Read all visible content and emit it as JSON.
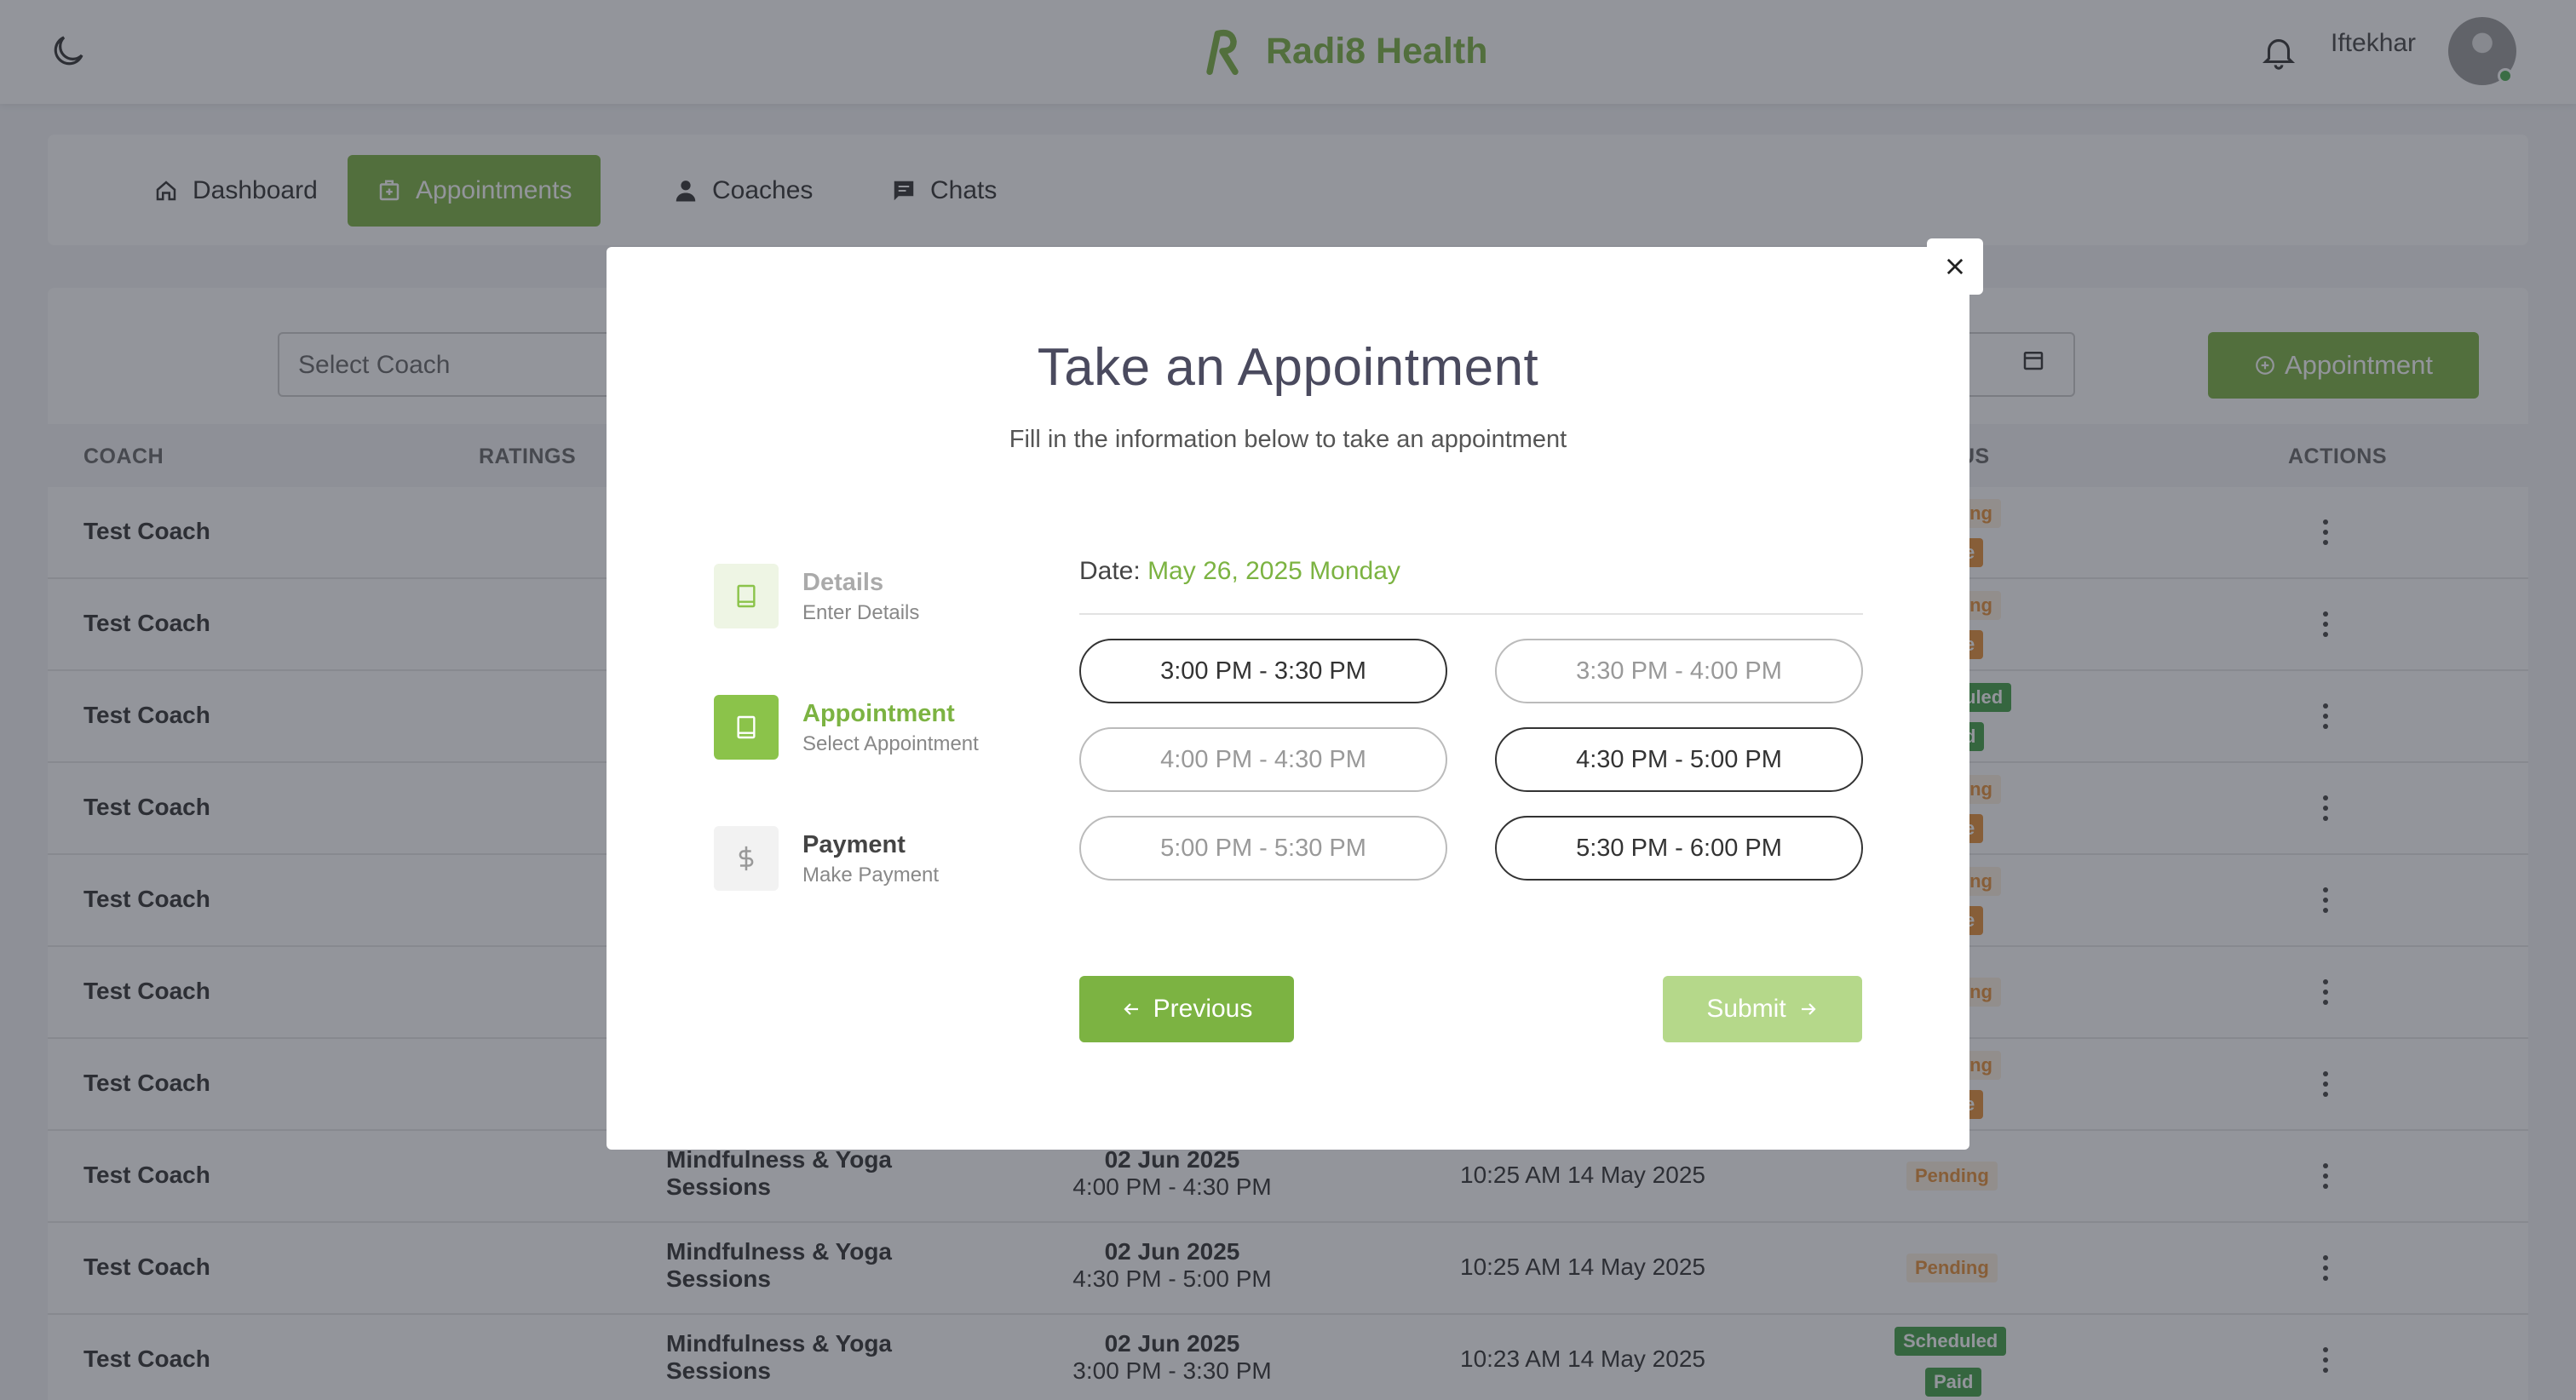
{
  "colors": {
    "accent": "#7cb342",
    "pending": "#e69138",
    "scheduled": "#43a047"
  },
  "header": {
    "brand": "Radi8 Health",
    "username": "Iftekhar"
  },
  "nav": {
    "items": [
      {
        "label": "Dashboard",
        "icon": "home-icon"
      },
      {
        "label": "Appointments",
        "icon": "calendar-plus-icon",
        "active": true
      },
      {
        "label": "Coaches",
        "icon": "coach-icon"
      },
      {
        "label": "Chats",
        "icon": "chat-icon"
      }
    ]
  },
  "filters": {
    "select_coach_placeholder": "Select Coach",
    "add_button": "Appointment"
  },
  "table": {
    "headers": {
      "coach": "COACH",
      "ratings": "RATINGS",
      "status": "US",
      "actions": "ACTIONS"
    },
    "rows": [
      {
        "coach": "Test Coach",
        "status_partial_1": "ing",
        "status_partial_2": "e"
      },
      {
        "coach": "Test Coach",
        "status_partial_1": "ing",
        "status_partial_2": "e"
      },
      {
        "coach": "Test Coach",
        "status_partial_1": "uled",
        "status_partial_2": "d"
      },
      {
        "coach": "Test Coach",
        "status_partial_1": "ing",
        "status_partial_2": "e"
      },
      {
        "coach": "Test Coach",
        "status_partial_1": "ing",
        "status_partial_2": "e"
      },
      {
        "coach": "Test Coach",
        "status_partial_1": "ing"
      },
      {
        "coach": "Test Coach",
        "status_partial_1": "ing",
        "status_partial_2": "e"
      },
      {
        "coach": "Test Coach",
        "service": "Mindfulness & Yoga Sessions",
        "date": "02 Jun 2025",
        "time": "4:00 PM - 4:30 PM",
        "created": "10:25 AM 14 May 2025",
        "status": "Pending"
      },
      {
        "coach": "Test Coach",
        "service": "Mindfulness & Yoga Sessions",
        "date": "02 Jun 2025",
        "time": "4:30 PM - 5:00 PM",
        "created": "10:25 AM 14 May 2025",
        "status": "Pending"
      },
      {
        "coach": "Test Coach",
        "service": "Mindfulness & Yoga Sessions",
        "date": "02 Jun 2025",
        "time": "3:00 PM - 3:30 PM",
        "created": "10:23 AM 14 May 2025",
        "status": "Scheduled",
        "payment": "Paid"
      }
    ]
  },
  "modal": {
    "title": "Take an Appointment",
    "subtitle": "Fill in the information below to take an appointment",
    "steps": [
      {
        "title": "Details",
        "desc": "Enter Details",
        "state": "done"
      },
      {
        "title": "Appointment",
        "desc": "Select Appointment",
        "state": "active"
      },
      {
        "title": "Payment",
        "desc": "Make Payment",
        "state": "todo"
      }
    ],
    "date_label": "Date:",
    "date_value": "May 26, 2025 Monday",
    "slots": [
      {
        "label": "3:00 PM - 3:30 PM",
        "enabled": true
      },
      {
        "label": "3:30 PM - 4:00 PM",
        "enabled": false
      },
      {
        "label": "4:00 PM - 4:30 PM",
        "enabled": false
      },
      {
        "label": "4:30 PM - 5:00 PM",
        "enabled": true
      },
      {
        "label": "5:00 PM - 5:30 PM",
        "enabled": false
      },
      {
        "label": "5:30 PM - 6:00 PM",
        "enabled": true
      }
    ],
    "previous_label": "Previous",
    "submit_label": "Submit"
  }
}
